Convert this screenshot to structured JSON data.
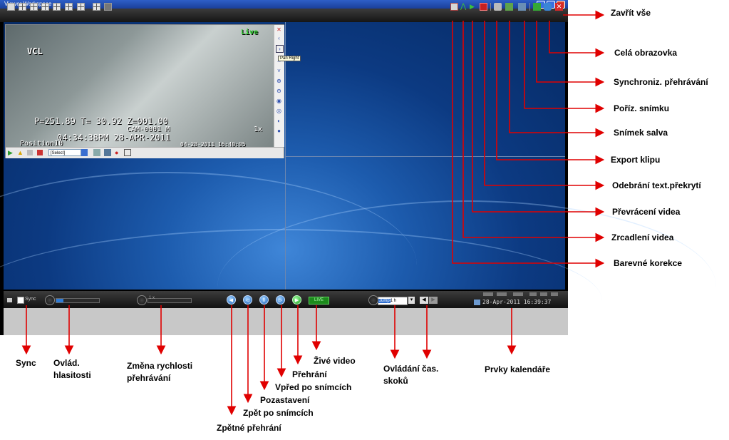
{
  "window": {
    "title": "Viewer Workspace"
  },
  "toolbar": {
    "layout_buttons": [
      "layout-1x1",
      "layout-2x2",
      "layout-1plus5",
      "layout-3x3",
      "layout-1plus7",
      "layout-4x4",
      "layout-1plus12",
      "layout-5x5"
    ],
    "right_icons": [
      "color-correction-icon",
      "mirror-icon",
      "flip-icon",
      "remove-overlay-icon",
      "export-clip-icon",
      "burst-snapshot-icon",
      "snapshot-icon",
      "sync-playback-icon",
      "fullscreen-icon",
      "close-all-icon"
    ]
  },
  "camera": {
    "osd_brand": "VCL",
    "osd_live": "Live",
    "osd_line1": "P=251.89 T= 30.92 Z=001.00",
    "osd_line2": "CAM-0001 M",
    "osd_zoom": "1x",
    "osd_time": "04:34:38PM 28-APR-2011",
    "osd_position": "Position10",
    "osd_timestamp": "04-28-2011 16:40:05",
    "tooltip": "Pan Right",
    "select_value": "[Select]"
  },
  "controlbar": {
    "sync_label": "Sync",
    "speed_value": "1 x",
    "live_label": "LIVE",
    "jump_label": "Jump",
    "jump_value": "1 h",
    "datetime": "28-Apr-2011 16:39:37"
  },
  "annotations": {
    "close_all": "Zavřít vše",
    "fullscreen": "Celá obrazovka",
    "sync_playback": "Synchroniz. přehrávání",
    "snapshot": "Poříz. snímku",
    "burst": "Snímek salva",
    "export_clip": "Export klipu",
    "remove_overlay": "Odebrání text.překrytí",
    "flip_video": "Převrácení videa",
    "mirror_video": "Zrcadlení videa",
    "color_correction": "Barevné korekce",
    "sync": "Sync",
    "volume_1": "Ovlád.",
    "volume_2": "hlasitosti",
    "speed_1": "Změna rychlosti",
    "speed_2": "přehrávání",
    "reverse": "Zpětné přehrání",
    "step_back": "Zpět po snímcích",
    "pause": "Pozastavení",
    "step_forward": "Vpřed po snímcích",
    "play": "Přehrání",
    "live_video": "Živé video",
    "jump_1": "Ovládání čas.",
    "jump_2": "skoků",
    "calendar": "Prvky kalendáře"
  },
  "colors": {
    "arrow": "#e00000",
    "desktop": "#0c3a82",
    "live": "#1c8a1c"
  }
}
